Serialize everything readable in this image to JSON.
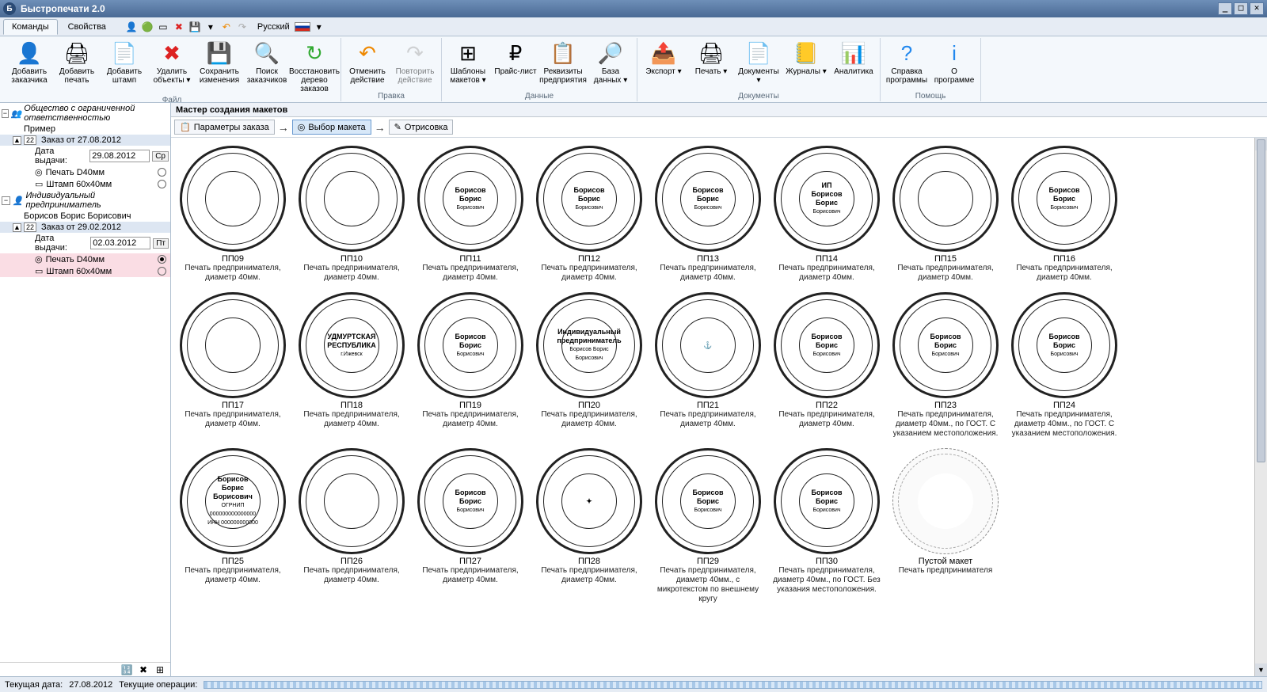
{
  "title": "Быстропечати 2.0",
  "menubar": {
    "tabs": [
      "Команды",
      "Свойства"
    ],
    "active_tab": 0,
    "language": "Русский"
  },
  "ribbon": {
    "groups": [
      {
        "label": "Файл",
        "items": [
          {
            "icon": "👤",
            "label": "Добавить заказчика"
          },
          {
            "icon": "🖨",
            "label": "Добавить печать"
          },
          {
            "icon": "📄",
            "label": "Добавить штамп"
          },
          {
            "icon": "✖",
            "label": "Удалить объекты ▾",
            "color": "#d22"
          },
          {
            "icon": "💾",
            "label": "Сохранить изменения"
          },
          {
            "icon": "🔍",
            "label": "Поиск заказчиков"
          },
          {
            "icon": "↻",
            "label": "Восстановить дерево заказов",
            "color": "#3a3"
          }
        ]
      },
      {
        "label": "Правка",
        "items": [
          {
            "icon": "↶",
            "label": "Отменить действие",
            "color": "#e80"
          },
          {
            "icon": "↷",
            "label": "Повторить действие",
            "color": "#aaa",
            "disabled": true
          }
        ]
      },
      {
        "label": "Данные",
        "items": [
          {
            "icon": "⊞",
            "label": "Шаблоны макетов ▾"
          },
          {
            "icon": "₽",
            "label": "Прайс-лист"
          },
          {
            "icon": "📋",
            "label": "Реквизиты предприятия"
          },
          {
            "icon": "🔎",
            "label": "База данных ▾"
          }
        ]
      },
      {
        "label": "Документы",
        "items": [
          {
            "icon": "📤",
            "label": "Экспорт ▾"
          },
          {
            "icon": "🖨",
            "label": "Печать ▾"
          },
          {
            "icon": "📄",
            "label": "Документы ▾"
          },
          {
            "icon": "📒",
            "label": "Журналы ▾"
          },
          {
            "icon": "📊",
            "label": "Аналитика"
          }
        ]
      },
      {
        "label": "Помощь",
        "items": [
          {
            "icon": "?",
            "label": "Справка программы",
            "color": "#28e"
          },
          {
            "icon": "i",
            "label": "О программе",
            "color": "#28e"
          }
        ]
      }
    ]
  },
  "sidebar": {
    "org1": "Общество с ограниченной ответственностью",
    "org1_example": "Пример",
    "order1_label": "Заказ от 27.08.2012",
    "order1_date_label": "Дата выдачи:",
    "order1_date": "29.08.2012",
    "order1_day": "Ср",
    "order1_item1": "Печать D40мм",
    "order1_item2": "Штамп 60х40мм",
    "org2": "Индивидуальный предприниматель",
    "org2_name": "Борисов Борис Борисович",
    "order2_label": "Заказ от 29.02.2012",
    "order2_date_label": "Дата выдачи:",
    "order2_date": "02.03.2012",
    "order2_day": "Пт",
    "order2_item1": "Печать D40мм",
    "order2_item2": "Штамп 60х40мм"
  },
  "main": {
    "header": "Мастер создания макетов",
    "steps": [
      "Параметры заказа",
      "Выбор макета",
      "Отрисовка"
    ],
    "active_step": 1
  },
  "templates": [
    {
      "code": "ПП09",
      "desc": "Печать предпринимателя, диаметр 40мм.",
      "centerA": "",
      "centerB": "",
      "centerC": ""
    },
    {
      "code": "ПП10",
      "desc": "Печать предпринимателя, диаметр 40мм.",
      "centerA": "",
      "centerB": "",
      "centerC": ""
    },
    {
      "code": "ПП11",
      "desc": "Печать предпринимателя, диаметр 40мм.",
      "centerA": "Борисов",
      "centerB": "Борис",
      "centerC": "Борисович"
    },
    {
      "code": "ПП12",
      "desc": "Печать предпринимателя, диаметр 40мм.",
      "centerA": "Борисов",
      "centerB": "Борис",
      "centerC": "Борисович"
    },
    {
      "code": "ПП13",
      "desc": "Печать предпринимателя, диаметр 40мм.",
      "centerA": "Борисов",
      "centerB": "Борис",
      "centerC": "Борисович"
    },
    {
      "code": "ПП14",
      "desc": "Печать предпринимателя, диаметр 40мм.",
      "centerA": "ИП",
      "centerB": "Борисов Борис",
      "centerC": "Борисович"
    },
    {
      "code": "ПП15",
      "desc": "Печать предпринимателя, диаметр 40мм.",
      "centerA": "",
      "centerB": "",
      "centerC": ""
    },
    {
      "code": "ПП16",
      "desc": "Печать предпринимателя, диаметр 40мм.",
      "centerA": "Борисов",
      "centerB": "Борис",
      "centerC": "Борисович"
    },
    {
      "code": "ПП17",
      "desc": "Печать предпринимателя, диаметр 40мм.",
      "centerA": "",
      "centerB": "",
      "centerC": ""
    },
    {
      "code": "ПП18",
      "desc": "Печать предпринимателя, диаметр 40мм.",
      "centerA": "",
      "centerB": "УДМУРТСКАЯ РЕСПУБЛИКА",
      "centerC": "г.Ижевск"
    },
    {
      "code": "ПП19",
      "desc": "Печать предпринимателя, диаметр 40мм.",
      "centerA": "Борисов",
      "centerB": "Борис",
      "centerC": "Борисович"
    },
    {
      "code": "ПП20",
      "desc": "Печать предпринимателя, диаметр 40мм.",
      "centerA": "Индивидуальный",
      "centerB": "предприниматель",
      "centerC": "Борисов Борис Борисович"
    },
    {
      "code": "ПП21",
      "desc": "Печать предпринимателя, диаметр 40мм.",
      "centerA": "",
      "centerB": "⚓",
      "centerC": ""
    },
    {
      "code": "ПП22",
      "desc": "Печать предпринимателя, диаметр 40мм.",
      "centerA": "Борисов",
      "centerB": "Борис",
      "centerC": "Борисович"
    },
    {
      "code": "ПП23",
      "desc": "Печать предпринимателя, диаметр 40мм., по ГОСТ. С указанием местоположения.",
      "centerA": "Борисов",
      "centerB": "Борис",
      "centerC": "Борисович"
    },
    {
      "code": "ПП24",
      "desc": "Печать предпринимателя, диаметр 40мм., по ГОСТ. С указанием местоположения.",
      "centerA": "Борисов",
      "centerB": "Борис",
      "centerC": "Борисович"
    },
    {
      "code": "ПП25",
      "desc": "Печать предпринимателя, диаметр 40мм.",
      "centerA": "Борисов",
      "centerB": "Борис Борисович",
      "centerC": "ОГРНИП 000000000000000 ИНН 000000000000"
    },
    {
      "code": "ПП26",
      "desc": "Печать предпринимателя, диаметр 40мм.",
      "centerA": "",
      "centerB": "",
      "centerC": ""
    },
    {
      "code": "ПП27",
      "desc": "Печать предпринимателя, диаметр 40мм.",
      "centerA": "Борисов",
      "centerB": "Борис",
      "centerC": "Борисович"
    },
    {
      "code": "ПП28",
      "desc": "Печать предпринимателя, диаметр 40мм.",
      "centerA": "",
      "centerB": "✦",
      "centerC": ""
    },
    {
      "code": "ПП29",
      "desc": "Печать предпринимателя, диаметр 40мм., с микротекстом по внешнему кругу",
      "centerA": "Борисов",
      "centerB": "Борис",
      "centerC": "Борисович"
    },
    {
      "code": "ПП30",
      "desc": "Печать предпринимателя, диаметр 40мм., по ГОСТ. Без указания местоположения.",
      "centerA": "Борисов",
      "centerB": "Борис",
      "centerC": "Борисович"
    },
    {
      "code": "Пустой макет",
      "desc": "Печать предпринимателя",
      "empty": true
    }
  ],
  "statusbar": {
    "date_label": "Текущая дата:",
    "date": "27.08.2012",
    "ops_label": "Текущие операции:"
  }
}
